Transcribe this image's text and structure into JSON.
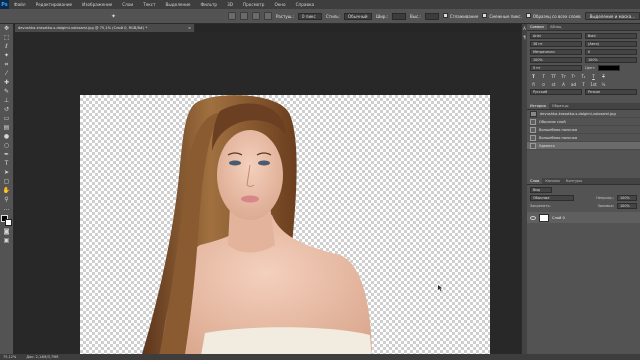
{
  "app": {
    "logo": "Ps"
  },
  "menubar": {
    "items": [
      "Файл",
      "Редактирование",
      "Изображение",
      "Слои",
      "Текст",
      "Выделение",
      "Фильтр",
      "3D",
      "Просмотр",
      "Окно",
      "Справка"
    ]
  },
  "options": {
    "feather_label": "Растуш.:",
    "feather_value": "0 пикс",
    "smooth_label": "Сглаживание",
    "style_label": "Стиль:",
    "style_value": "Обычный",
    "width_label": "Шир.:",
    "height_label": "Выс.:",
    "refine_button": "Выделение и маска...",
    "antialias_label": "Сглаживание",
    "contiguous_label": "Смежные пикс.",
    "all_layers_label": "Образец со всех слоев"
  },
  "document": {
    "tab_title": "devushka-krasotka-s-dolgimi-volosami.jpg @ 75,1% (Слой 0, RGB/8#) *",
    "zoom": "75,12%",
    "status": "Док: 2,14М/3,79М"
  },
  "character": {
    "tabs": [
      "Символ",
      "Абзац"
    ],
    "font_family": "Arial",
    "font_style": "Bold",
    "font_size": "36 пт",
    "leading": "(Авто)",
    "kerning": "Метрически",
    "tracking": "0",
    "vscale": "100%",
    "hscale": "100%",
    "baseline": "0 пт",
    "color_label": "Цвет:",
    "style_buttons": [
      "T",
      "T",
      "TT",
      "Tт",
      "T¹",
      "T₁",
      "T",
      "T"
    ],
    "feature_buttons": [
      "fi",
      "σ",
      "st",
      "A",
      "ad",
      "T",
      "1st",
      "½"
    ],
    "language": "Русский",
    "aa": "Резкое"
  },
  "history": {
    "tabs": [
      "История",
      "Образцы"
    ],
    "snapshot": "devushka-krasotka-s-dolgimi-volosami.jpg",
    "items": [
      "Обычное слой",
      "Волшебная палочка",
      "Волшебная палочка",
      "Удалить"
    ]
  },
  "layers": {
    "tabs": [
      "Слои",
      "Каналы",
      "Контуры"
    ],
    "kind_label": "Вид",
    "blend_mode": "Обычные",
    "opacity_label": "Непрозр.:",
    "opacity_value": "100%",
    "lock_label": "Закрепить:",
    "fill_label": "Заливка:",
    "fill_value": "100%",
    "items": [
      {
        "name": "Слой 0"
      }
    ]
  },
  "colors": {
    "menubar": "#3e3e3e",
    "panel": "#535353",
    "workspace": "#282828",
    "accent": "#31a8ff"
  }
}
